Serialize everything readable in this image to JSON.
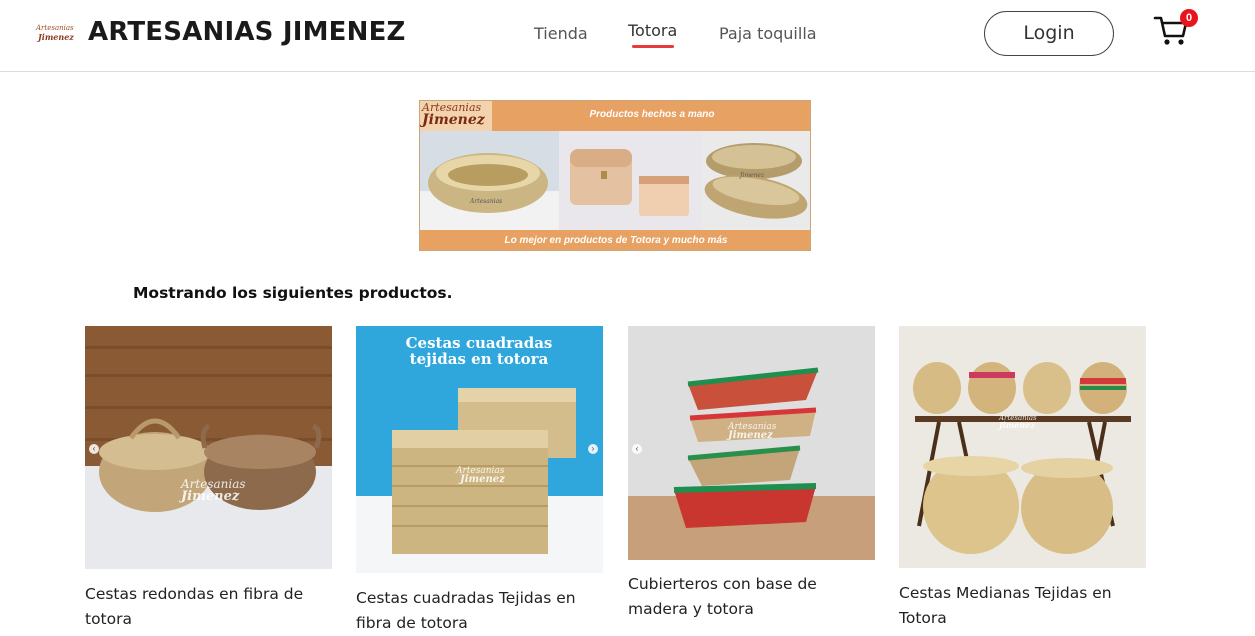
{
  "header": {
    "logo_line1": "Artesanias",
    "logo_line2": "Jimenez",
    "brand": "ARTESANIAS JIMENEZ",
    "nav": [
      {
        "label": "Tienda"
      },
      {
        "label": "Totora",
        "active": true
      },
      {
        "label": "Paja toquilla"
      }
    ],
    "login_label": "Login",
    "cart_count": "0",
    "cart_icon": "shopping-cart-icon",
    "accent_color": "#e83a3a"
  },
  "banner": {
    "logo_line1": "Artesanias",
    "logo_line2": "Jimenez",
    "tagline": "Productos hechos a mano",
    "footer": "Lo mejor en productos de Totora y mucho más",
    "watermark1": "Artesanias",
    "watermark2": "Jimenez",
    "color": "#e6a163"
  },
  "section_title": "Mostrando los siguientes productos.",
  "products": [
    {
      "title": "Cestas redondas en fibra de totora",
      "wm1": "Artesanias",
      "wm2": "Jimenez"
    },
    {
      "title": "Cestas cuadradas Tejidas en fibra de totora",
      "overlay_line1": "Cestas cuadradas",
      "overlay_line2": "tejidas en totora",
      "wm1": "Artesanias",
      "wm2": "Jimenez"
    },
    {
      "title": "Cubierteros con base de madera y totora",
      "wm1": "Artesanias",
      "wm2": "Jimenez"
    },
    {
      "title": "Cestas Medianas Tejidas en Totora",
      "wm1": "Artesanias",
      "wm2": "Jimenez"
    }
  ]
}
